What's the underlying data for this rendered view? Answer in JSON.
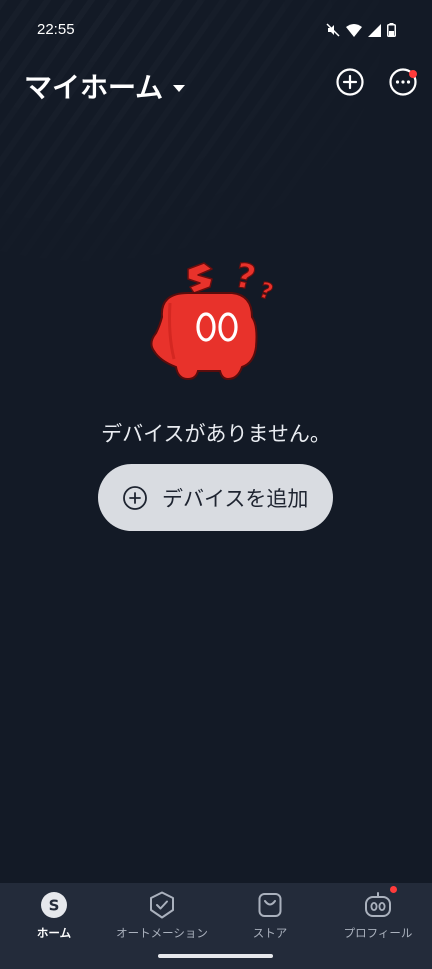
{
  "status_bar": {
    "time": "22:55",
    "icons": [
      "mute-icon",
      "wifi-icon",
      "signal-icon",
      "battery-icon"
    ]
  },
  "header": {
    "title": "マイホーム",
    "add_icon": "plus-circle-icon",
    "more_icon": "more-circle-icon",
    "notification_dot_color": "#ff3b3b"
  },
  "empty_state": {
    "message": "デバイスがありません。",
    "add_button_label": "デバイスを追加",
    "mascot_color": "#e8322b"
  },
  "bottom_nav": {
    "items": [
      {
        "label": "ホーム",
        "icon": "home-s-icon",
        "active": true
      },
      {
        "label": "オートメーション",
        "icon": "automation-shield-icon",
        "active": false
      },
      {
        "label": "ストア",
        "icon": "store-bag-icon",
        "active": false
      },
      {
        "label": "プロフィール",
        "icon": "profile-robot-icon",
        "active": false,
        "badge": true
      }
    ]
  },
  "colors": {
    "background": "#131a26",
    "nav_background": "#232b3a",
    "button_background": "#d9dce1",
    "accent_red": "#ff3b3b"
  }
}
